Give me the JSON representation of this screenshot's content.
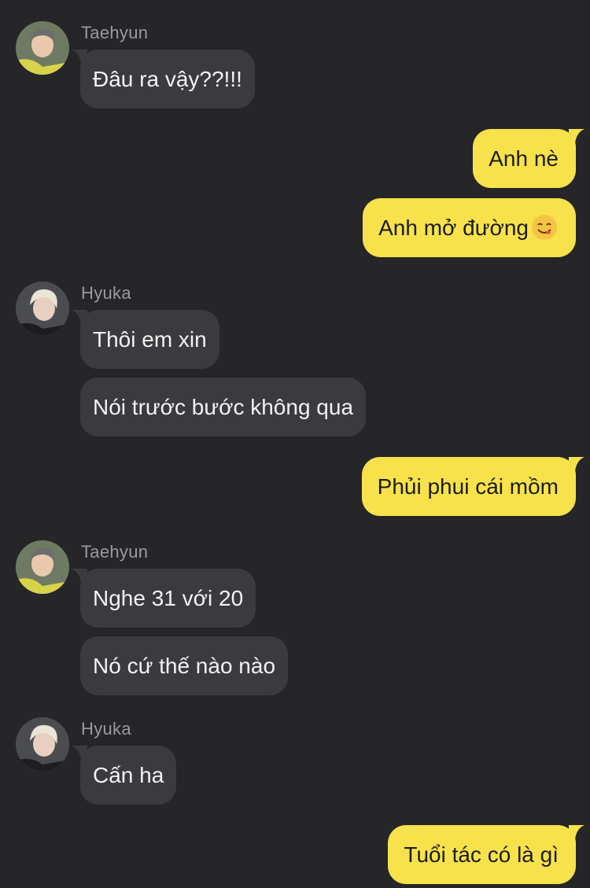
{
  "chat": {
    "colors": {
      "background": "#262629",
      "incoming_bubble": "#3b3b3f",
      "outgoing_bubble": "#f7e24b",
      "sender_name": "#9a9a9e"
    },
    "senders": {
      "taehyun": "Taehyun",
      "hyuka": "Hyuka"
    },
    "messages": [
      {
        "from": "Taehyun",
        "text": "Đâu ra vậy??!!!"
      },
      {
        "from": "me",
        "text": "Anh nè"
      },
      {
        "from": "me",
        "text": "Anh mở đường",
        "emoji": "yum-face-emoji"
      },
      {
        "from": "Hyuka",
        "text": "Thôi em xin"
      },
      {
        "from": "Hyuka",
        "text": "Nói trước bước không qua"
      },
      {
        "from": "me",
        "text": "Phủi phui cái mồm"
      },
      {
        "from": "Taehyun",
        "text": "Nghe 31 với 20"
      },
      {
        "from": "Taehyun",
        "text": "Nó cứ thế nào nào"
      },
      {
        "from": "Hyuka",
        "text": "Cấn ha"
      },
      {
        "from": "me",
        "text": "Tuổi tác có là gì"
      }
    ]
  }
}
